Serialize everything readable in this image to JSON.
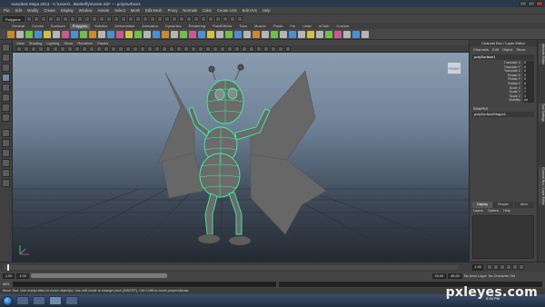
{
  "titlebar": {
    "title": "Autodesk Maya 2013 - C:\\Users\\...\\Butterfly\\Scene.mb* --- polySurface1"
  },
  "menubar": {
    "items": [
      "File",
      "Edit",
      "Modify",
      "Create",
      "Display",
      "Window",
      "Assets",
      "Select",
      "Mesh",
      "Edit Mesh",
      "Proxy",
      "Normals",
      "Color",
      "Create UVs",
      "Edit UVs",
      "Help"
    ]
  },
  "statusline": {
    "mode": "Polygons"
  },
  "shelf": {
    "tabs": [
      "General",
      "Curves",
      "Surfaces",
      "Polygons",
      "Subdivs",
      "Deformation",
      "Animation",
      "Dynamics",
      "Rendering",
      "PaintEffects",
      "Toon",
      "Muscle",
      "Fluids",
      "Fur",
      "nHair",
      "nCloth",
      "Custom"
    ],
    "active_tab": "Polygons",
    "icon_colors": [
      "#c98a2d",
      "#b5b5b5",
      "#6fbf4a",
      "#4d8fd1",
      "#d0c04a",
      "#b5b5b5",
      "#c75a8f",
      "#4d8fd1",
      "#6fbf4a",
      "#c98a2d",
      "#b5b5b5",
      "#4d8fd1",
      "#c75a8f",
      "#d0c04a",
      "#6fbf4a",
      "#b5b5b5",
      "#4d8fd1",
      "#c98a2d",
      "#b5b5b5",
      "#6fbf4a",
      "#c75a8f",
      "#4d8fd1",
      "#d0c04a",
      "#b5b5b5",
      "#6fbf4a",
      "#4d8fd1",
      "#b5b5b5",
      "#c98a2d",
      "#b5b5b5",
      "#6fbf4a",
      "#b5b5b5",
      "#4d8fd1",
      "#b5b5b5",
      "#d0c04a",
      "#b5b5b5",
      "#6fbf4a",
      "#c75a8f",
      "#b5b5b5",
      "#4d8fd1",
      "#b5b5b5"
    ]
  },
  "viewport": {
    "menu": [
      "View",
      "Shading",
      "Lighting",
      "Show",
      "Renderer",
      "Panels"
    ],
    "view_cube_label": "FRONT",
    "wire_color": "#3df2a0",
    "mesh_color": "#6e6e6e",
    "grid_color": "#2a2f36"
  },
  "channel_box": {
    "header": "Channel Box / Layer Editor",
    "menu": [
      "Channels",
      "Edit",
      "Object",
      "Show"
    ],
    "object_name": "polySurface1",
    "attributes": [
      {
        "name": "Translate X",
        "value": "0"
      },
      {
        "name": "Translate Y",
        "value": "0"
      },
      {
        "name": "Translate Z",
        "value": "0"
      },
      {
        "name": "Rotate X",
        "value": "0"
      },
      {
        "name": "Rotate Y",
        "value": "0"
      },
      {
        "name": "Rotate Z",
        "value": "0"
      },
      {
        "name": "Scale X",
        "value": "1"
      },
      {
        "name": "Scale Y",
        "value": "1"
      },
      {
        "name": "Scale Z",
        "value": "1"
      },
      {
        "name": "Visibility",
        "value": "on"
      }
    ],
    "shapes_label": "SHAPES",
    "shape_name": "polySurfaceShape1",
    "layer_tabs": [
      "Display",
      "Render",
      "Anim"
    ],
    "layer_menu": [
      "Layers",
      "Options",
      "Help"
    ]
  },
  "side_tabs": [
    "Attribute Editor",
    "Tool Settings",
    "Channel Box / Layer Editor"
  ],
  "timeslider": {
    "current_frame": "1.00"
  },
  "rangeslider": {
    "start": "1.00",
    "inner_start": "1.00",
    "inner_end": "24",
    "end": "24.00",
    "end2": "48.00",
    "anim_layer": "No Anim Layer",
    "char_set": "No Character Set"
  },
  "cmdline": {
    "label": "MEL"
  },
  "helpline": {
    "text": "Move Tool: Use manipulator to move object(s). Use edit mode to change pivot (INSERT). Ctrl+LMB to move perpendicular."
  },
  "taskbar": {
    "clock": "6:33 PM"
  },
  "watermark": {
    "text": "pxleyes.com"
  }
}
